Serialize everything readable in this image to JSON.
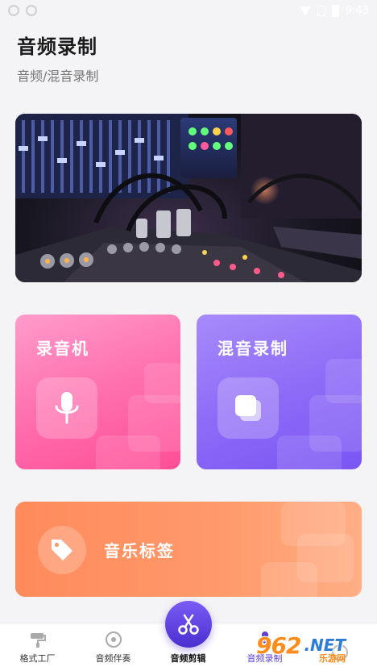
{
  "status_bar": {
    "time": "9:43",
    "icons": [
      "app-icon",
      "app-icon",
      "wifi-icon",
      "no-sim-icon",
      "battery-icon"
    ]
  },
  "header": {
    "title": "音频录制",
    "subtitle": "音频/混音录制"
  },
  "banner": {
    "image": "audio-mixer-console-photo"
  },
  "cards": {
    "recorder": {
      "label": "录音机",
      "icon": "microphone-icon",
      "color": "#ff5fa0"
    },
    "mix": {
      "label": "混音录制",
      "icon": "layers-icon",
      "color": "#8a66f6"
    },
    "tag": {
      "label": "音乐标签",
      "icon": "tag-icon",
      "color": "#ff915f"
    }
  },
  "nav": {
    "items": [
      {
        "label": "格式工厂",
        "icon": "paint-roller-icon"
      },
      {
        "label": "音频伴奏",
        "icon": "disc-icon"
      },
      {
        "label": "音频剪辑",
        "icon": "scissors-icon"
      },
      {
        "label": "音频录制",
        "icon": "microphone-icon",
        "active": true
      },
      {
        "label": "",
        "icon": "more-icon"
      }
    ],
    "accent": "#5b3fd8"
  },
  "watermark": {
    "brand": "962",
    "domain": ".NET",
    "sub": "乐游网"
  }
}
